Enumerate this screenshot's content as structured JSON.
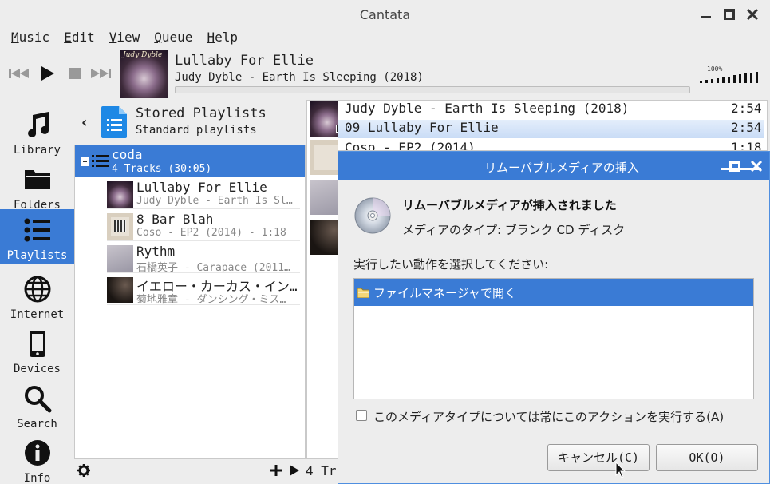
{
  "window": {
    "title": "Cantata"
  },
  "menu": {
    "items": [
      "Music",
      "Edit",
      "View",
      "Queue",
      "Help"
    ]
  },
  "now_playing": {
    "title": "Lullaby For Ellie",
    "subtitle": "Judy Dyble - Earth Is Sleeping (2018)",
    "cover_text": "Judy Dyble",
    "progress": 0
  },
  "volume": {
    "label": "100%",
    "level": 1.0
  },
  "sidebar": {
    "items": [
      {
        "label": "Library",
        "icon": "music-note-icon"
      },
      {
        "label": "Folders",
        "icon": "folder-icon"
      },
      {
        "label": "Playlists",
        "icon": "list-icon",
        "active": true
      },
      {
        "label": "Internet",
        "icon": "globe-icon"
      },
      {
        "label": "Devices",
        "icon": "phone-icon"
      },
      {
        "label": "Search",
        "icon": "search-icon"
      },
      {
        "label": "Info",
        "icon": "info-icon"
      }
    ]
  },
  "playlists": {
    "header_title": "Stored Playlists",
    "header_subtitle": "Standard playlists",
    "group": {
      "name": "coda",
      "meta": "4 Tracks (30:05)"
    },
    "tracks": [
      {
        "title": "Lullaby For Ellie",
        "sub": "Judy Dyble - Earth Is Sl…"
      },
      {
        "title": "8 Bar Blah",
        "sub": "Coso - EP2 (2014) - 1:18"
      },
      {
        "title": "Rythm",
        "sub": "石橋英子 - Carapace (2011…"
      },
      {
        "title": "イエロー・カーカス・イン…",
        "sub": "菊地雅章 - ダンシング・ミス…"
      }
    ],
    "footer_tracks": "4 Tr"
  },
  "queue": {
    "rows": [
      {
        "text": "Judy Dyble - Earth Is Sleeping (2018)",
        "duration": "2:54"
      },
      {
        "text": "09 Lullaby For Ellie",
        "duration": "2:54"
      },
      {
        "text": "Coso - EP2 (2014)",
        "duration": "1:18"
      }
    ]
  },
  "dialog": {
    "title": "リムーバブルメディアの挿入",
    "heading": "リムーバブルメディアが挿入されました",
    "media_type": "メディアのタイプ: ブランク CD ディスク",
    "prompt": "実行したい動作を選択してください:",
    "options": [
      "ファイルマネージャで開く"
    ],
    "always_label": "このメディアタイプについては常にこのアクションを実行する(A)",
    "cancel_label": "キャンセル(C)",
    "ok_label": "OK(O)"
  },
  "colors": {
    "accent": "#3a7bd5",
    "background": "#ededed"
  }
}
